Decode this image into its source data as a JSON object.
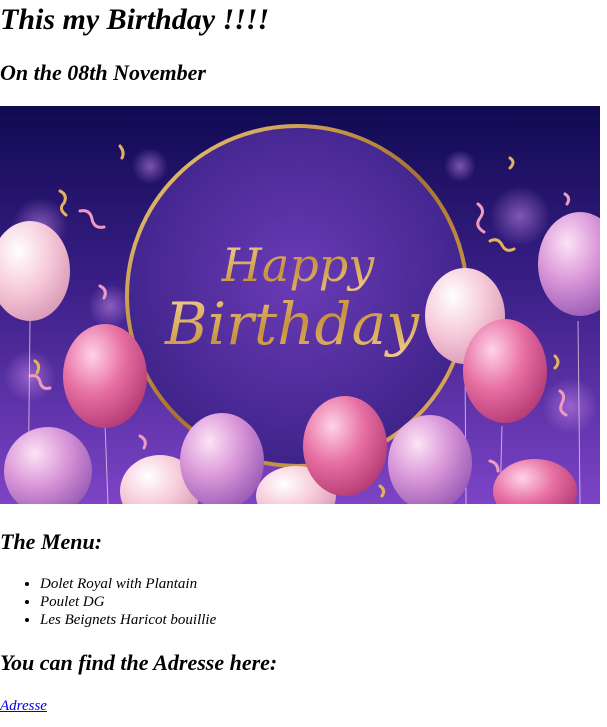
{
  "page": {
    "title": "This my Birthday !!!!",
    "subtitle": "On the 08th November"
  },
  "banner": {
    "text_line1": "Happy",
    "text_line2": "Birthday",
    "colors": {
      "bg_top": "#140a55",
      "bg_bottom": "#7a3fc4",
      "ring": "#c9973a",
      "text_gold": "#e0b36a"
    }
  },
  "menu": {
    "heading": "The Menu:",
    "items": [
      "Dolet Royal with Plantain",
      "Poulet DG",
      "Les Beignets Haricot bouillie"
    ]
  },
  "address": {
    "heading": "You can find the Adresse here:",
    "link_label": "Adresse"
  }
}
